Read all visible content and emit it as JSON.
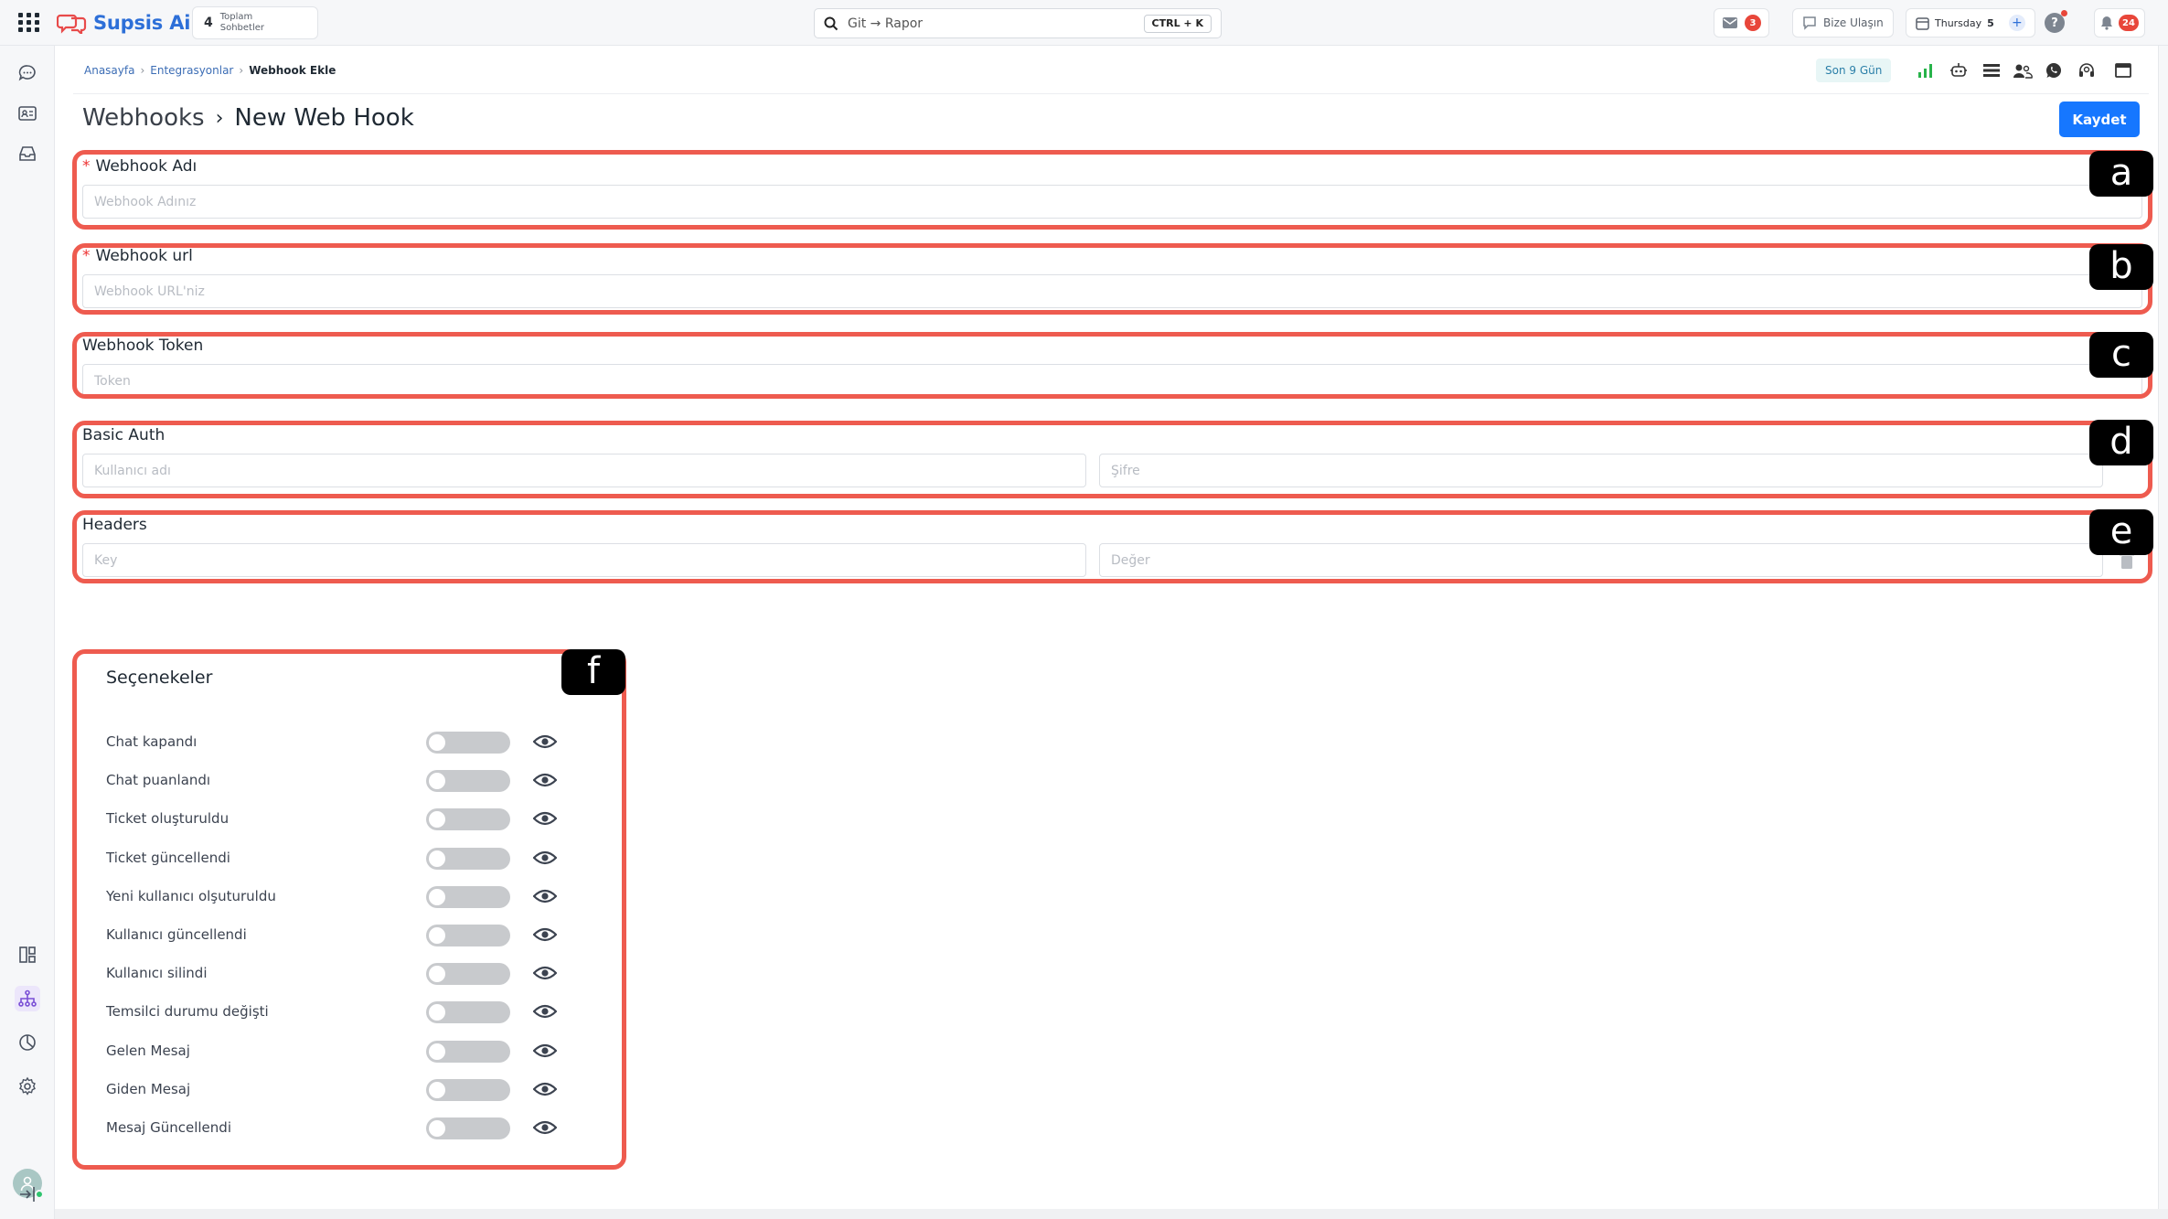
{
  "topbar": {
    "brand": "Supsis Ai",
    "conversations": {
      "count": "4",
      "label_line1": "Toplam",
      "label_line2": "Sohbetler"
    },
    "search": {
      "value": "Git → Rapor",
      "shortcut": "CTRL + K"
    },
    "mail_badge": "3",
    "contact_label": "Bize Ulaşın",
    "calendar": {
      "day": "Thursday",
      "date": "5"
    },
    "notifications_badge": "24"
  },
  "breadcrumb": {
    "home": "Anasayfa",
    "integrations": "Entegrasyonlar",
    "current": "Webhook Ekle"
  },
  "toolbar": {
    "period": "Son 9 Gün"
  },
  "page": {
    "root": "Webhooks",
    "title": "New Web Hook",
    "save_label": "Kaydet"
  },
  "form": {
    "name": {
      "label": "Webhook Adı",
      "placeholder": "Webhook Adınız"
    },
    "url": {
      "label": "Webhook url",
      "placeholder": "Webhook URL'niz"
    },
    "token": {
      "label": "Webhook Token",
      "placeholder": "Token"
    },
    "basic_auth": {
      "label": "Basic Auth",
      "username_placeholder": "Kullanıcı adı",
      "password_placeholder": "Şifre"
    },
    "headers": {
      "label": "Headers",
      "key_placeholder": "Key",
      "value_placeholder": "Değer"
    }
  },
  "options": {
    "title": "Seçenekeler",
    "items": [
      {
        "label": "Chat kapandı",
        "enabled": false
      },
      {
        "label": "Chat puanlandı",
        "enabled": false
      },
      {
        "label": "Ticket oluşturuldu",
        "enabled": false
      },
      {
        "label": "Ticket güncellendi",
        "enabled": false
      },
      {
        "label": "Yeni kullanıcı olşuturuldu",
        "enabled": false
      },
      {
        "label": "Kullanıcı güncellendi",
        "enabled": false
      },
      {
        "label": "Kullanıcı silindi",
        "enabled": false
      },
      {
        "label": "Temsilci durumu değişti",
        "enabled": false
      },
      {
        "label": "Gelen Mesaj",
        "enabled": false
      },
      {
        "label": "Giden Mesaj",
        "enabled": false
      },
      {
        "label": "Mesaj Güncellendi",
        "enabled": false
      }
    ]
  },
  "annotations": {
    "a": "a",
    "b": "b",
    "c": "c",
    "d": "d",
    "e": "e",
    "f": "f"
  },
  "colors": {
    "primary": "#1677ff",
    "highlight": "#ee5b4f",
    "brand": "#2d6fd8",
    "badge": "#e8463a"
  }
}
